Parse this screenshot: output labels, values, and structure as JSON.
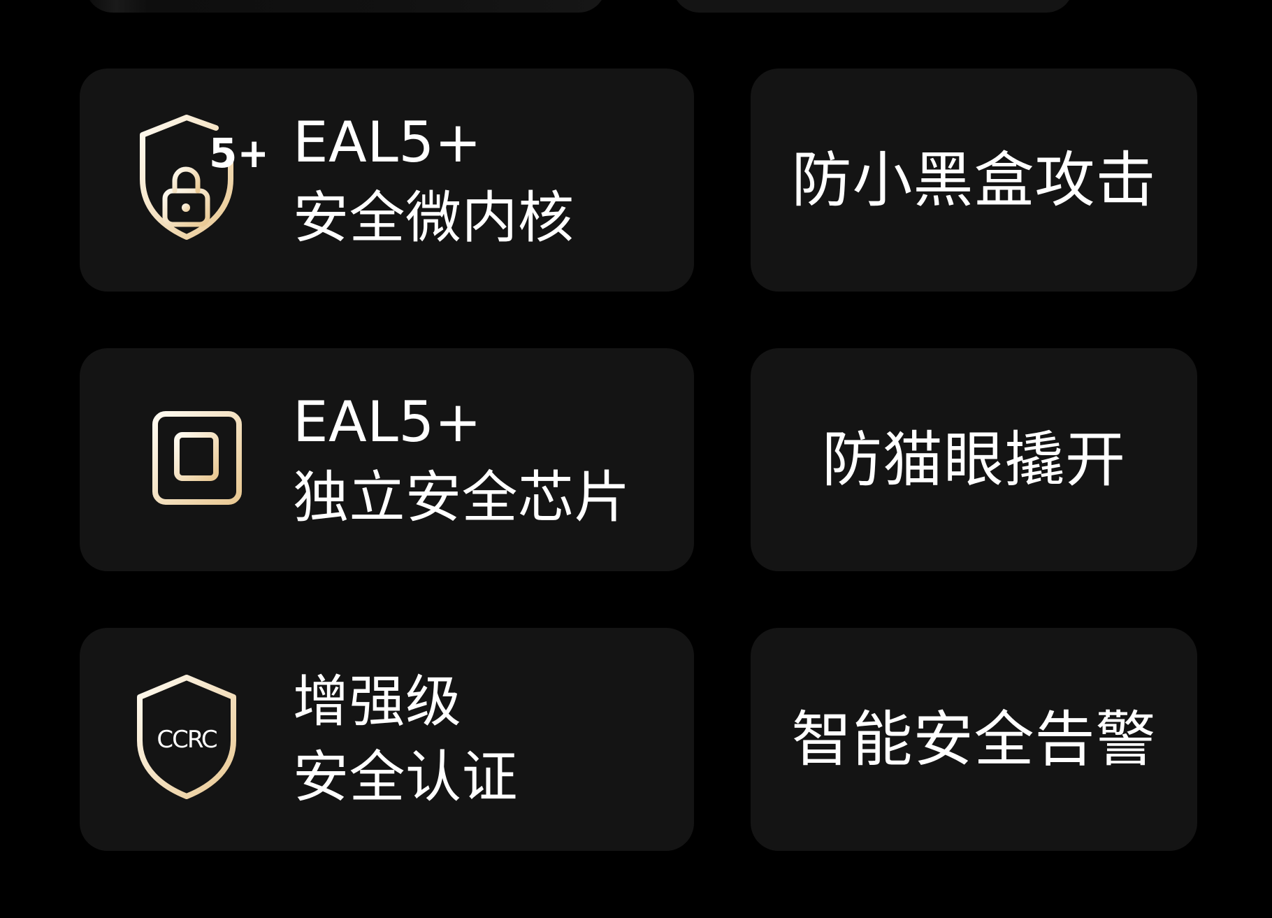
{
  "features": [
    {
      "icon": "shield-lock-5plus-icon",
      "badge": "5+",
      "line1": "EAL5+",
      "line2": "安全微内核",
      "right": "防小黑盒攻击"
    },
    {
      "icon": "chip-icon",
      "line1": "EAL5+",
      "line2": "独立安全芯片",
      "right": "防猫眼撬开"
    },
    {
      "icon": "shield-ccrc-icon",
      "badge": "CCRC",
      "line1": "增强级",
      "line2": "安全认证",
      "right": "智能安全告警"
    }
  ],
  "colors": {
    "background": "#000000",
    "card": "#141414",
    "text": "#ffffff",
    "icon_gold_start": "#fffbf2",
    "icon_gold_end": "#e9c892"
  }
}
